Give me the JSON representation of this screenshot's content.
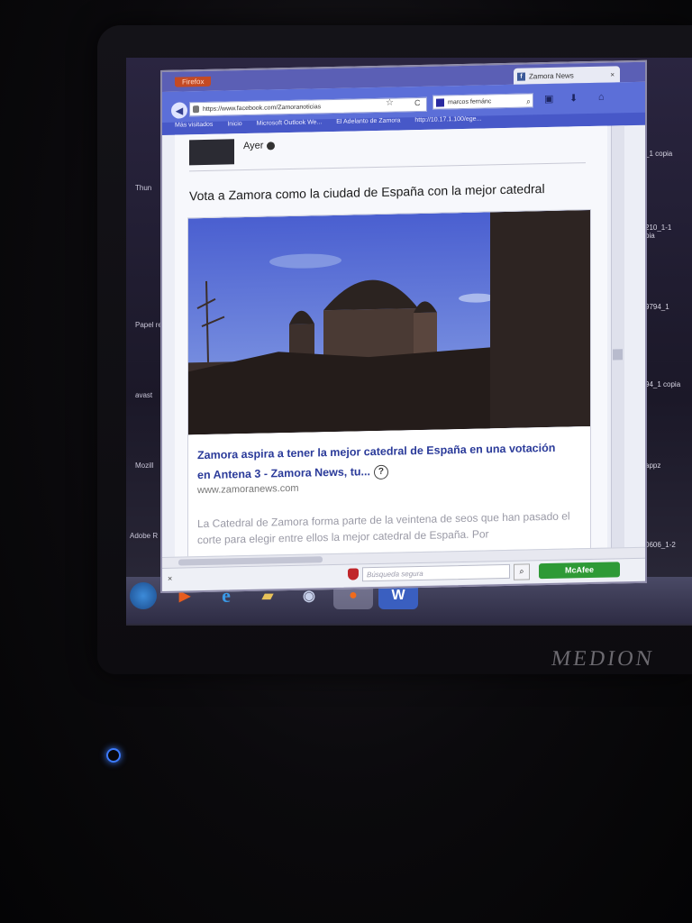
{
  "browser": {
    "menu_label": "Firefox",
    "tab_title": "Zamora News",
    "url": "https://www.facebook.com/Zamoranoticias",
    "search_value": "marcos fernánc",
    "bookmarks": [
      "Más visitados",
      "Inicio",
      "Microsoft Outlook We...",
      "El Adelanto de Zamora",
      "http://10.17.1.100/ege..."
    ]
  },
  "post": {
    "time": "Ayer",
    "text": "Vota a Zamora como la ciudad de España con la mejor catedral"
  },
  "link_card": {
    "title": "Zamora aspira a tener la mejor catedral de España en una votación en Antena 3 - Zamora News, tu...",
    "domain": "www.zamoranews.com",
    "description": "La Catedral de Zamora forma parte de la veintena de seos que han pasado el corte para elegir entre ellos la mejor catedral de España. Por"
  },
  "addon_bar": {
    "search_placeholder": "Búsqueda segura",
    "mcafee_label": "McAfee"
  },
  "desktop_icons_left": [
    "Thun",
    "Papel rec",
    "avast",
    "Mozill",
    "Adobe R"
  ],
  "desktop_icons_right": [
    "_1 copia",
    "210_1-1 pia",
    "9794_1",
    "94_1 copia",
    "appz",
    "0606_1-2"
  ],
  "monitor_brand": "MEDION",
  "colors": {
    "firefox_nav": "#5c6fd8",
    "facebook_link": "#2b3b9a",
    "mcafee_green": "#2e9a36"
  }
}
